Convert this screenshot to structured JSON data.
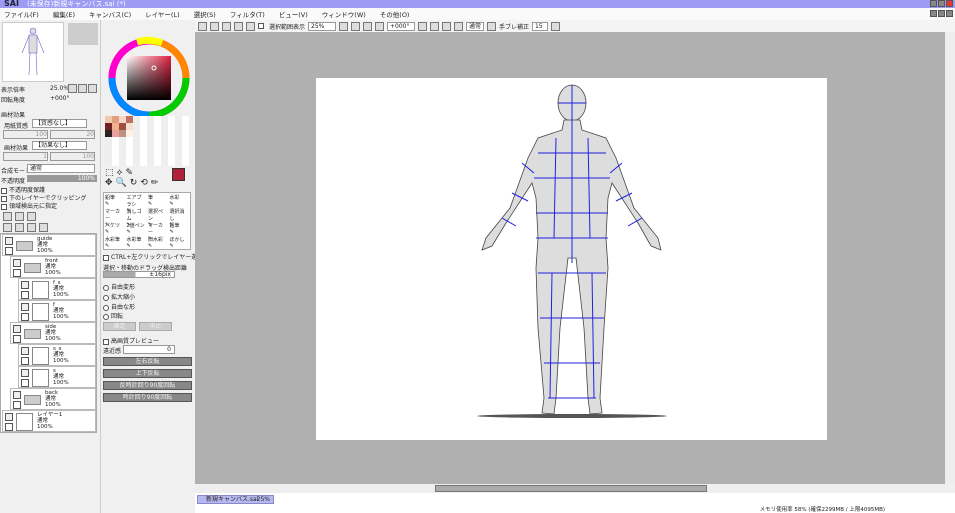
{
  "window": {
    "app": "SAI",
    "title": "(未保存)新規キャンバス.sai (*)"
  },
  "menu": [
    "ファイル(F)",
    "編集(E)",
    "キャンバス(C)",
    "レイヤー(L)",
    "選択(S)",
    "フィルタ(T)",
    "ビュー(V)",
    "ウィンドウ(W)",
    "その他(O)"
  ],
  "toolbar": {
    "show_selection_label": "選択範囲表示",
    "zoom": "25%",
    "rotation": "+000°",
    "blend": "通常",
    "stabilizer_label": "手ブレ補正",
    "stabilizer": "15"
  },
  "navigator": {
    "zoom_label": "表示倍率",
    "zoom": "25.0%",
    "angle_label": "回転角度",
    "angle": "+000°"
  },
  "texture": {
    "header": "画材効果",
    "paper_label": "用紙質感",
    "paper_value": "【質感なし】",
    "paper_strength": "100",
    "paper_scale": "20",
    "effect_label": "画材効果",
    "effect_value": "【効果なし】",
    "effect_strength": "1",
    "effect_scale": "100"
  },
  "layer_props": {
    "blend_label": "合成モード",
    "blend_value": "通常",
    "opacity_label": "不透明度",
    "opacity": "100%",
    "opacity_fraction": 1.0,
    "preserve_opacity": "不透明度保護",
    "clip": "下のレイヤーでクリッピング",
    "selection_source": "領域検出元に指定"
  },
  "layers": [
    {
      "name": "guide",
      "mode": "通常",
      "opacity": "100%",
      "type": "folder",
      "indent": 0
    },
    {
      "name": "front",
      "mode": "通常",
      "opacity": "100%",
      "type": "folder",
      "indent": 1
    },
    {
      "name": "f_s",
      "mode": "通常",
      "opacity": "100%",
      "type": "layer",
      "indent": 2
    },
    {
      "name": "f",
      "mode": "通常",
      "opacity": "100%",
      "type": "layer",
      "indent": 2
    },
    {
      "name": "side",
      "mode": "通常",
      "opacity": "100%",
      "type": "folder",
      "indent": 1
    },
    {
      "name": "s_s",
      "mode": "通常",
      "opacity": "100%",
      "type": "layer",
      "indent": 2
    },
    {
      "name": "s",
      "mode": "通常",
      "opacity": "100%",
      "type": "layer",
      "indent": 2
    },
    {
      "name": "back",
      "mode": "通常",
      "opacity": "100%",
      "type": "folder",
      "indent": 1
    },
    {
      "name": "レイヤー1",
      "mode": "通常",
      "opacity": "100%",
      "type": "layer",
      "indent": 0
    }
  ],
  "tools": [
    "鉛筆",
    "エアブラシ",
    "筆",
    "水彩",
    "マーカー",
    "消しゴム",
    "選択ペン",
    "選択消し",
    "バケツ",
    "2値ペン",
    "マーカー",
    "鉛筆",
    "水彩筆",
    "水彩筆",
    "旧水彩",
    "ぼかし"
  ],
  "transform": {
    "ctrl_select": "CTRL+左クリックでレイヤー選択",
    "drag_label": "選択・移動のドラッグ検出距離",
    "drag_value": "±16pix",
    "modes": [
      "自由変形",
      "拡大縮小",
      "自由な形",
      "回転"
    ],
    "ok": "確定",
    "cancel": "中止",
    "hq_preview": "高画質プレビュー",
    "perspective_label": "遠近感",
    "perspective": "0",
    "buttons": [
      "左右反転",
      "上下反転",
      "反時計回り90度回転",
      "時計回り90度回転"
    ]
  },
  "colors": {
    "main": "#b0203a",
    "titlebar": "#9c9cf4",
    "guide": "#2020e0"
  },
  "tab": {
    "name": "新規キャンバス.sai",
    "zoom": "25%"
  },
  "status": "メモリ使用率 58% (確保2299MB / 上限4095MB)"
}
